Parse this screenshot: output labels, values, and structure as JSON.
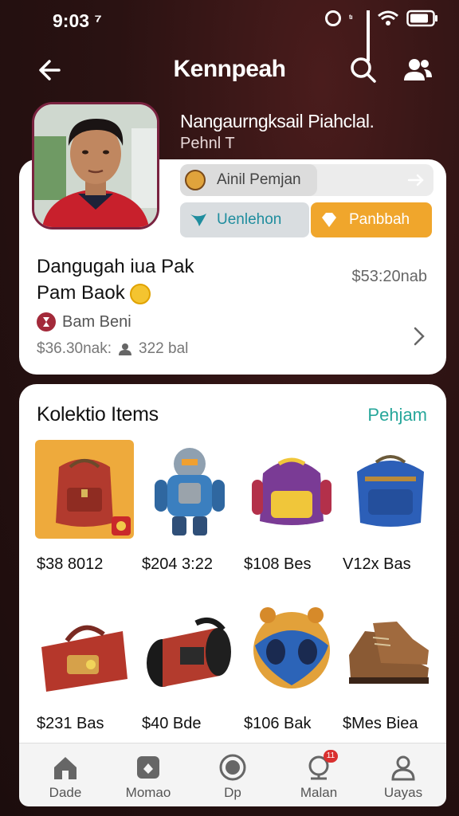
{
  "status_bar": {
    "time": "9:03 ⁷",
    "data_label": "ᵗᶦ"
  },
  "header": {
    "title": "Kennpeah"
  },
  "profile": {
    "name": "Nangaurngksail Piahclal.",
    "subtitle": "Pehnl T"
  },
  "share": {
    "label": "Ainil Pemjan"
  },
  "actions": {
    "follow_label": "Uenlehon",
    "buy_label": "Panbbah"
  },
  "listing": {
    "title_line1": "Dangugah iua Pak",
    "title_line2": "Pam Baok",
    "price": "$53:20nab",
    "seller": "Bam Beni",
    "stats_price": "$36.30nak:",
    "stats_count": "322 bal"
  },
  "collection": {
    "title": "Kolektio Items",
    "link": "Pehjam",
    "items": [
      {
        "name": "red-backpack",
        "price": "$38 8012"
      },
      {
        "name": "robot-figure",
        "price": "$204 3:22"
      },
      {
        "name": "purple-backpack",
        "price": "$108 Bes"
      },
      {
        "name": "blue-backpack",
        "price": "V12x Bas"
      },
      {
        "name": "red-duffel-bag",
        "price": "$231 Bas"
      },
      {
        "name": "black-roll-bag",
        "price": "$40 Bde"
      },
      {
        "name": "alien-helmet",
        "price": "$106 Bak"
      },
      {
        "name": "brown-boots",
        "price": "$Mes Biea"
      }
    ]
  },
  "nav": {
    "items": [
      {
        "label": "Dade",
        "icon": "home-icon"
      },
      {
        "label": "Momao",
        "icon": "store-icon"
      },
      {
        "label": "Dp",
        "icon": "camera-icon"
      },
      {
        "label": "Malan",
        "icon": "notification-icon",
        "badge": "11"
      },
      {
        "label": "Uayas",
        "icon": "user-icon"
      }
    ]
  },
  "colors": {
    "accent_teal": "#27a79b",
    "accent_orange": "#f0a62c",
    "avatar_border": "#7a2340"
  }
}
